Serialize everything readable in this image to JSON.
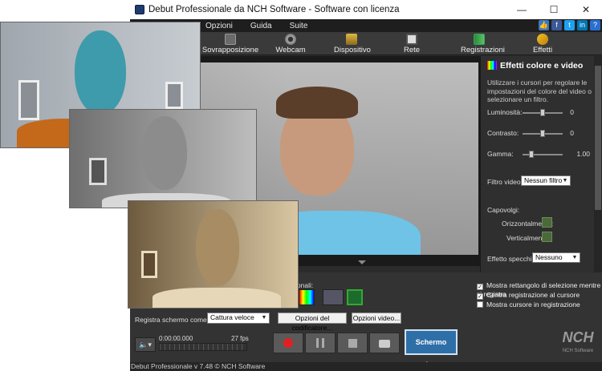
{
  "window": {
    "title": "Debut Professionale da NCH Software - Software con licenza",
    "minimize": "—",
    "maximize": "☐",
    "close": "✕"
  },
  "menu": {
    "items": [
      "Opzioni",
      "Guida",
      "Suite"
    ],
    "icons": [
      "thumbs-up-icon",
      "facebook-icon",
      "twitter-icon",
      "linkedin-icon",
      "help-icon"
    ]
  },
  "toolbar": {
    "items": [
      {
        "label": "Sovrapposizione camera",
        "icon": "camera-overlay-icon"
      },
      {
        "label": "Webcam",
        "icon": "webcam-icon"
      },
      {
        "label": "Dispositivo",
        "icon": "device-icon"
      },
      {
        "label": "Rete",
        "icon": "network-icon"
      },
      {
        "label": "Registrazioni",
        "icon": "recordings-icon"
      },
      {
        "label": "Effetti",
        "icon": "effects-icon"
      }
    ]
  },
  "effects_panel": {
    "title": "Effetti colore e video",
    "description": "Utilizzare i cursori per regolare le impostazioni del colore del video o selezionare un filtro.",
    "brightness": {
      "label": "Luminosità:",
      "value": "0",
      "level": 0.5
    },
    "contrast": {
      "label": "Contrasto:",
      "value": "0",
      "level": 0.5
    },
    "gamma": {
      "label": "Gamma:",
      "value": "1.00",
      "level": 0.2
    },
    "filter": {
      "label": "Filtro video:",
      "selected": "Nessun filtro"
    },
    "flip": {
      "label": "Capovolgi:",
      "horizontal": "Orizzontalmente:",
      "vertical": "Verticalmente:"
    },
    "mirror": {
      "label": "Effetto specchio:",
      "selected": "Nessuno"
    }
  },
  "options": {
    "label_partial": "ionali:",
    "checks": [
      {
        "label": "Mostra rettangolo di selezione mentre si registra",
        "checked": true
      },
      {
        "label": "Centra registrazione al cursore",
        "checked": true
      },
      {
        "label": "Mostra cursore in registrazione",
        "checked": false
      }
    ]
  },
  "record": {
    "label": "Registra schermo come:",
    "format": "Cattura veloce",
    "encoder_button": "Opzioni del codificatore...",
    "video_button": "Opzioni video...",
    "time": "0:00:00.000",
    "fps": "27 fps",
    "fullscreen": "Schermo pieno"
  },
  "status": "Debut Professionale v 7.48 © NCH Software",
  "brand": "NCH Software"
}
